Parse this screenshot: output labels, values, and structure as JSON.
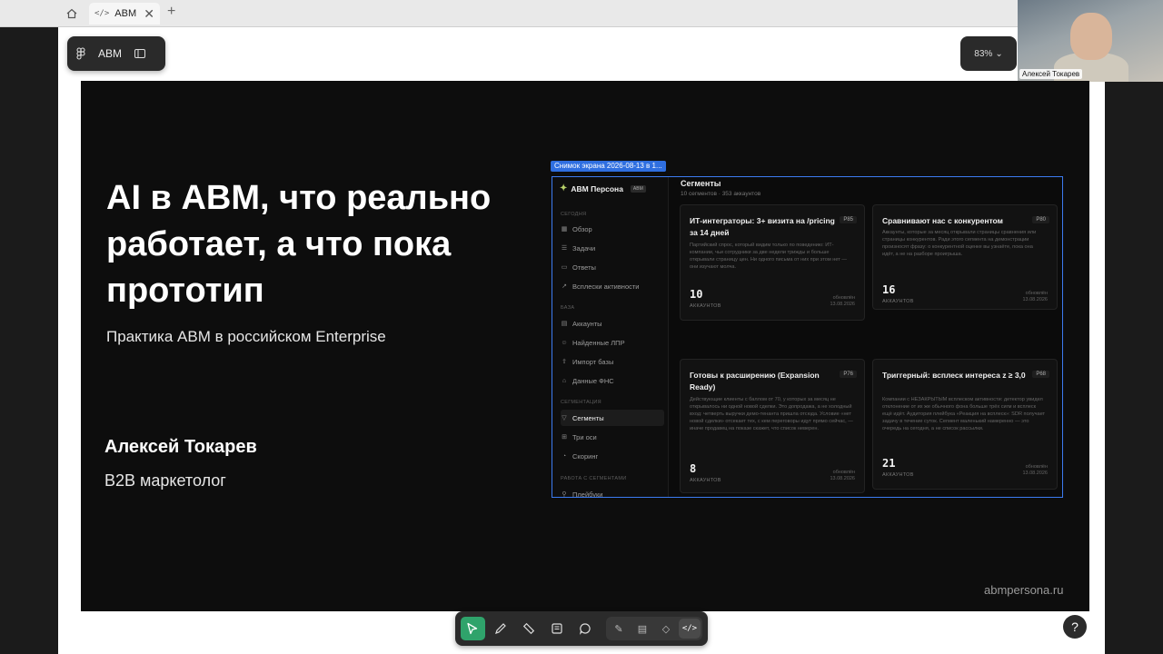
{
  "topbar": {
    "tab_title": "ABM",
    "tab_code": "</>",
    "close_glyph": "✕",
    "new_tab_glyph": "+"
  },
  "pill_left": {
    "label": "ABM"
  },
  "zoom": {
    "value": "83%",
    "chevron": "⌄"
  },
  "webcam": {
    "name": "Алексей Токарев"
  },
  "slide": {
    "title": "AI в ABM, что реально работает, а что пока прототип",
    "subtitle": "Практика ABM в российском Enterprise",
    "author": "Алексей Токарев",
    "role": "B2B маркетолог",
    "site": "abmpersona.ru"
  },
  "screenshot": {
    "label": "Снимок экрана 2026-08-13 в 1...",
    "brand": "ABM Персона",
    "brand_tag": "ABM",
    "sections": {
      "today": "СЕГОДНЯ",
      "base": "БАЗА",
      "segmentation": "СЕГМЕНТАЦИЯ",
      "work": "РАБОТА С СЕГМЕНТАМИ"
    },
    "nav": {
      "overview": "Обзор",
      "tasks": "Задачи",
      "answers": "Ответы",
      "spikes": "Всплески активности",
      "accounts": "Аккаунты",
      "found": "Найденные ЛПР",
      "import": "Импорт базы",
      "fns": "Данные ФНС",
      "segments": "Сегменты",
      "axes": "Три оси",
      "scoring": "Скоринг",
      "playbooks": "Плейбуки"
    },
    "header": "Сегменты",
    "subheader": "10 сегментов · 353 аккаунтов",
    "cards": [
      {
        "title": "ИТ-интеграторы: 3+ визита на /pricing за 14 дней",
        "tag": "P85",
        "desc": "Партийский спрос, который видим только по поведению: ИТ-компании, чьи сотрудники за две недели трижды и больше открывали страницу цен. Ни одного письма от них при этом нет — они изучают молча.",
        "count": "10",
        "acc": "АККАУНТОВ",
        "updated_label": "обновлён",
        "updated_date": "13.08.2026"
      },
      {
        "title": "Сравнивают нас с конкурентом",
        "tag": "P80",
        "desc": "Аккаунты, которые за месяц открывали страницы сравнения или страницы конкурентов. Ради этого сегмента на демонстрации произносят фразу: о конкурентной оценке вы узнаёте, пока она идёт, а не на разборе проигрыша.",
        "count": "16",
        "acc": "АККАУНТОВ",
        "updated_label": "обновлён",
        "updated_date": "13.08.2026"
      },
      {
        "title": "Готовы к расширению (Expansion Ready)",
        "tag": "P76",
        "desc": "Действующие клиенты с баллом от 70, у которых за месяц не открывалось ни одной новой сделки. Это допродажа, а не холодный вход: четверть выручки демо-тенанта пришла отсюда. Условие «нет новой сделки» отсекает тех, с кем переговоры идут прямо сейчас, — иначе продавец на показе скажет, что список неверен.",
        "count": "8",
        "acc": "АККАУНТОВ",
        "updated_label": "обновлён",
        "updated_date": "13.08.2026"
      },
      {
        "title": "Триггерный: всплеск интереса z ≥ 3,0",
        "tag": "P68",
        "desc": "Компании с НЕЗАКРЫТЫМ всплеском активности: детектор увидел отклонение от их же обычного фона больше трёх сигм и всплеск ещё идёт. Аудитория плейбука «Реакция на всплеск»: SDR получает задачу в течение суток. Сегмент маленький намеренно — это очередь на сегодня, а не список рассылки.",
        "count": "21",
        "acc": "АККАУНТОВ",
        "updated_label": "обновлён",
        "updated_date": "13.08.2026"
      }
    ]
  },
  "toolbar": {
    "code_label": "</>"
  },
  "help": {
    "label": "?"
  }
}
